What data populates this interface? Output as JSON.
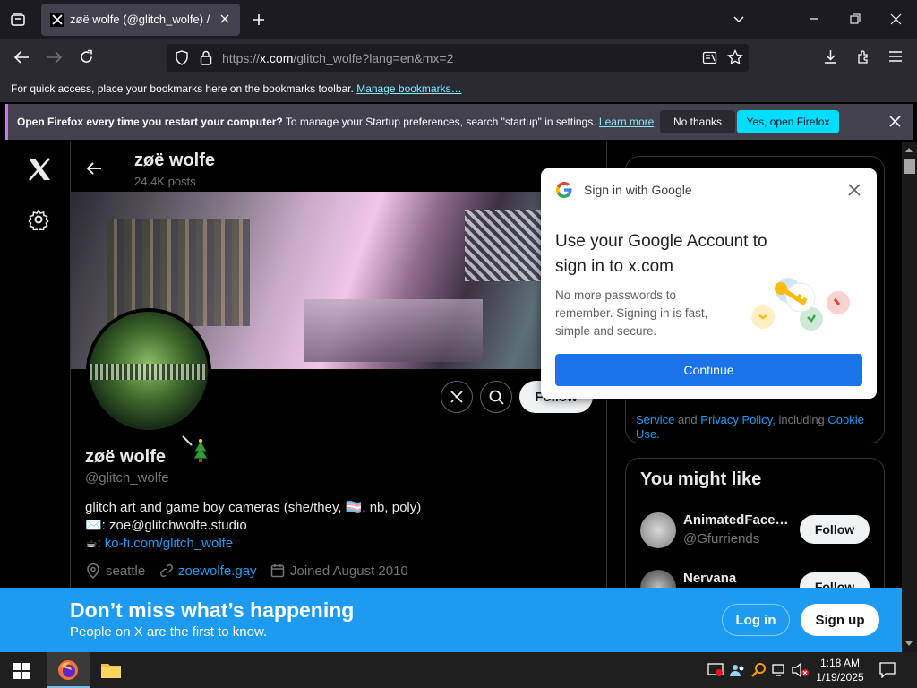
{
  "browser": {
    "tab_title": "zøë wolfe (@glitch_wolfe) / X",
    "url_prefix": "https://",
    "url_host": "x.com",
    "url_path": "/glitch_wolfe?lang=en&mx=2",
    "bookmarks_text": "For quick access, place your bookmarks here on the bookmarks toolbar.",
    "bookmarks_link": "Manage bookmarks…",
    "notification_bold": "Open Firefox every time you restart your computer?",
    "notification_text": " To manage your Startup preferences, search \"startup\" in settings.",
    "notification_link": "Learn more",
    "no_thanks": "No thanks",
    "yes_open": "Yes, open Firefox"
  },
  "profile": {
    "header_name": "zøë wolfe",
    "header_posts": "24.4K posts",
    "follow_label": "Follow",
    "name": "zøë wolfe",
    "handle": "@glitch_wolfe",
    "bio_line1": "glitch art and game boy cameras (she/they, 🏳️‍⚧️, nb, poly)",
    "bio_line2_prefix": "✉️: ",
    "bio_line2": "zoe@glitchwolfe.studio",
    "bio_line3_prefix": "☕: ",
    "bio_line3": "ko-fi.com/glitch_wolfe",
    "location": "seattle",
    "website": "zoewolfe.gay",
    "joined": "Joined August 2010"
  },
  "right": {
    "terms_service": "Service",
    "terms_and": " and ",
    "terms_privacy": "Privacy Policy",
    "terms_including": ", including ",
    "terms_cookie": "Cookie Use.",
    "might_like_title": "You might like",
    "suggestions": [
      {
        "name": "AnimatedFace…",
        "handle": "@Gfurriends",
        "follow": "Follow"
      },
      {
        "name": "Nervana",
        "handle": "",
        "follow": "Follow"
      }
    ]
  },
  "google_popup": {
    "header": "Sign in with Google",
    "heading": "Use your Google Account to sign in to x.com",
    "description": "No more passwords to remember. Signing in is fast, simple and secure.",
    "continue": "Continue"
  },
  "bottom_banner": {
    "headline": "Don’t miss what’s happening",
    "subline": "People on X are the first to know.",
    "login": "Log in",
    "signup": "Sign up"
  },
  "taskbar": {
    "time": "1:18 AM",
    "date": "1/19/2025"
  }
}
